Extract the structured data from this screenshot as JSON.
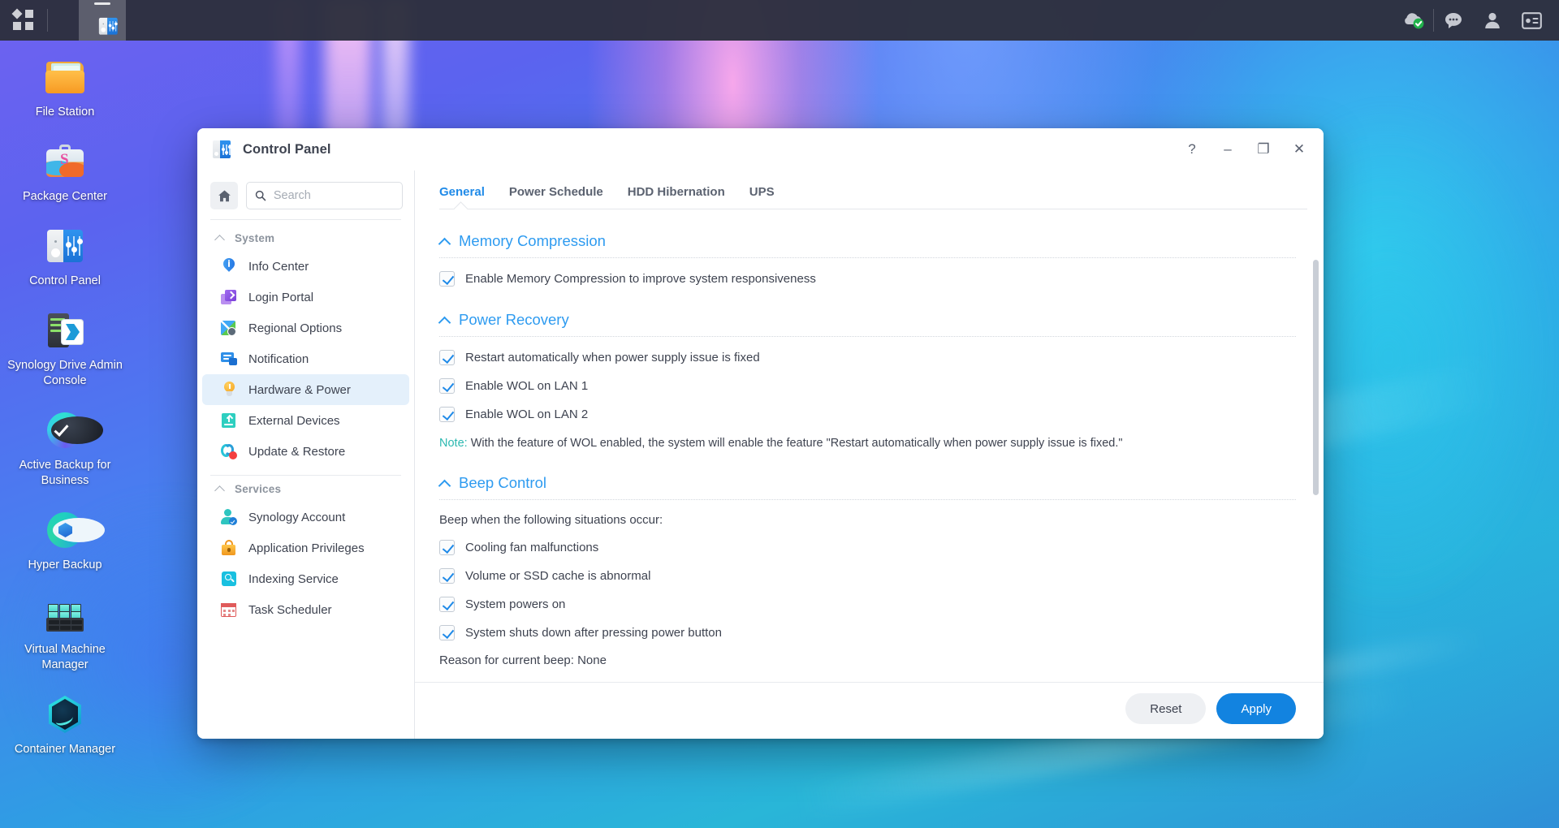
{
  "taskbar": {
    "left": [
      {
        "name": "app-menu",
        "icon": "grid-icon"
      },
      {
        "name": "control-panel-task",
        "icon": "control-panel-icon"
      }
    ],
    "right": [
      {
        "name": "cloud-status",
        "icon": "cloud-check-icon"
      },
      {
        "name": "notifications",
        "icon": "chat-bubble-icon"
      },
      {
        "name": "user-account",
        "icon": "person-icon"
      },
      {
        "name": "widgets",
        "icon": "widget-panel-icon"
      }
    ]
  },
  "desktop": {
    "icons": [
      {
        "label": "File Station",
        "icon": "file-station-icon"
      },
      {
        "label": "Package Center",
        "icon": "package-center-icon"
      },
      {
        "label": "Control Panel",
        "icon": "control-panel-icon"
      },
      {
        "label": "Synology Drive Admin Console",
        "icon": "synology-drive-icon"
      },
      {
        "label": "Active Backup for Business",
        "icon": "active-backup-icon"
      },
      {
        "label": "Hyper Backup",
        "icon": "hyper-backup-icon"
      },
      {
        "label": "Virtual Machine Manager",
        "icon": "vmm-icon"
      },
      {
        "label": "Container Manager",
        "icon": "container-manager-icon"
      }
    ]
  },
  "window": {
    "title": "Control Panel",
    "controls": {
      "help": "?",
      "minimize": "–",
      "maximize": "❐",
      "close": "✕"
    }
  },
  "sidebar": {
    "home_icon": "home-icon",
    "search": {
      "placeholder": "Search",
      "value": "",
      "icon": "search-icon"
    },
    "groups": [
      {
        "label": "System",
        "items": [
          {
            "label": "Info Center",
            "icon": "info-center-icon",
            "active": false
          },
          {
            "label": "Login Portal",
            "icon": "login-portal-icon",
            "active": false
          },
          {
            "label": "Regional Options",
            "icon": "regional-options-icon",
            "active": false
          },
          {
            "label": "Notification",
            "icon": "notification-icon",
            "active": false
          },
          {
            "label": "Hardware & Power",
            "icon": "hardware-power-icon",
            "active": true
          },
          {
            "label": "External Devices",
            "icon": "external-devices-icon",
            "active": false
          },
          {
            "label": "Update & Restore",
            "icon": "update-restore-icon",
            "active": false,
            "badge": true
          }
        ]
      },
      {
        "label": "Services",
        "items": [
          {
            "label": "Synology Account",
            "icon": "synology-account-icon",
            "active": false
          },
          {
            "label": "Application Privileges",
            "icon": "application-privileges-icon",
            "active": false
          },
          {
            "label": "Indexing Service",
            "icon": "indexing-service-icon",
            "active": false
          },
          {
            "label": "Task Scheduler",
            "icon": "task-scheduler-icon",
            "active": false
          }
        ]
      }
    ]
  },
  "main": {
    "tabs": [
      {
        "label": "General",
        "active": true
      },
      {
        "label": "Power Schedule",
        "active": false
      },
      {
        "label": "HDD Hibernation",
        "active": false
      },
      {
        "label": "UPS",
        "active": false
      }
    ],
    "sections": [
      {
        "title": "Memory Compression",
        "checkboxes": [
          {
            "label": "Enable Memory Compression to improve system responsiveness",
            "checked": true
          }
        ]
      },
      {
        "title": "Power Recovery",
        "checkboxes": [
          {
            "label": "Restart automatically when power supply issue is fixed",
            "checked": true
          },
          {
            "label": "Enable WOL on LAN 1",
            "checked": true
          },
          {
            "label": "Enable WOL on LAN 2",
            "checked": true
          }
        ],
        "note_prefix": "Note:",
        "note_body": " With the feature of WOL enabled, the system will enable the feature \"Restart automatically when power supply issue is fixed.\""
      },
      {
        "title": "Beep Control",
        "intro": "Beep when the following situations occur:",
        "checkboxes": [
          {
            "label": "Cooling fan malfunctions",
            "checked": true
          },
          {
            "label": "Volume or SSD cache is abnormal",
            "checked": true
          },
          {
            "label": "System powers on",
            "checked": true
          },
          {
            "label": "System shuts down after pressing power button",
            "checked": true
          }
        ],
        "status": "Reason for current beep: None"
      }
    ],
    "footer": {
      "reset_label": "Reset",
      "apply_label": "Apply"
    }
  },
  "colors": {
    "accent": "#1f8ae8",
    "section_title": "#2e9bf0",
    "note_label": "#2bb8b0",
    "apply_bg": "#1283e0",
    "active_item_bg": "#e4f0fb"
  }
}
